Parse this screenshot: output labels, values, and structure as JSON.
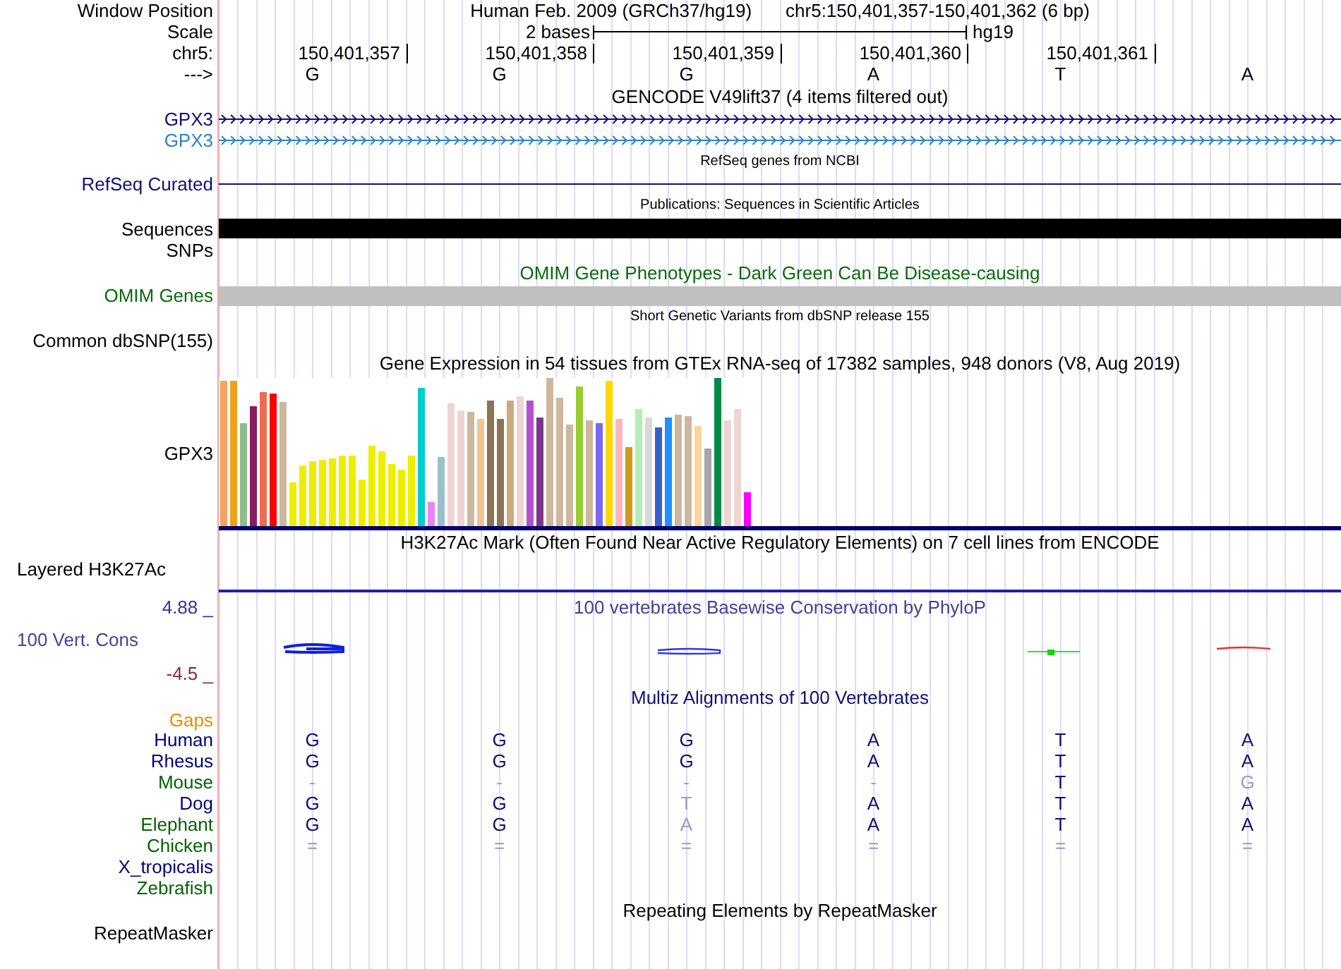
{
  "header": {
    "position_label": "Window Position",
    "assembly": "Human Feb. 2009 (GRCh37/hg19)",
    "position": "chr5:150,401,357-150,401,362 (6 bp)",
    "scale_label": "Scale",
    "scale_length": "2 bases",
    "scale_assembly": "hg19",
    "ruler_label": "chr5:",
    "ruler_ticks": [
      "150,401,357",
      "150,401,358",
      "150,401,359",
      "150,401,360",
      "150,401,361"
    ],
    "strand_label": "--->",
    "bases": [
      "G",
      "G",
      "G",
      "A",
      "T",
      "A"
    ]
  },
  "tracks": [
    {
      "kind": "title",
      "text": "GENCODE V49lift37 (4 items filtered out)"
    },
    {
      "kind": "gene",
      "label": "GPX3"
    },
    {
      "kind": "gene-alt",
      "label": "GPX3"
    },
    {
      "kind": "note",
      "text": "RefSeq genes from NCBI"
    },
    {
      "kind": "line",
      "label": "RefSeq Curated"
    },
    {
      "kind": "note",
      "text": "Publications: Sequences in Scientific Articles"
    },
    {
      "kind": "sequence-bar",
      "label": "Sequences"
    },
    {
      "kind": "label",
      "label": "SNPs"
    },
    {
      "kind": "omim-title",
      "text": "OMIM Gene Phenotypes - Dark Green Can Be Disease-causing"
    },
    {
      "kind": "omim-bar",
      "label": "OMIM Genes"
    },
    {
      "kind": "note",
      "text": "Short Genetic Variants from dbSNP release 155"
    },
    {
      "kind": "label",
      "label": "Common dbSNP(155)"
    },
    {
      "kind": "title",
      "text": "Gene Expression in 54 tissues from GTEx RNA-seq of 17382 samples, 948 donors (V8, Aug 2019)"
    },
    {
      "kind": "expression",
      "label": "GPX3"
    },
    {
      "kind": "title",
      "text": "H3K27Ac Mark (Often Found Near Active Regulatory Elements) on 7 cell lines from ENCODE"
    },
    {
      "kind": "layered",
      "label": "Layered H3K27Ac"
    },
    {
      "kind": "wiggle",
      "title": "100 vertebrates Basewise Conservation by PhyloP",
      "label": "100 Vert. Cons",
      "max": "4.88 _",
      "min": "-4.5 _"
    },
    {
      "kind": "multiz-title",
      "text": "Multiz Alignments of 100 Vertebrates"
    },
    {
      "kind": "gaps",
      "label": "Gaps"
    },
    {
      "kind": "species",
      "label": "Human",
      "color": "#000080",
      "bases": [
        {
          "text": "G",
          "faded": false
        },
        {
          "text": "G",
          "faded": false
        },
        {
          "text": "G",
          "faded": false
        },
        {
          "text": "A",
          "faded": false
        },
        {
          "text": "T",
          "faded": false
        },
        {
          "text": "A",
          "faded": false
        }
      ]
    },
    {
      "kind": "species",
      "label": "Rhesus",
      "color": "#000080",
      "bases": [
        {
          "text": "G",
          "faded": false
        },
        {
          "text": "G",
          "faded": false
        },
        {
          "text": "G",
          "faded": false
        },
        {
          "text": "A",
          "faded": false
        },
        {
          "text": "T",
          "faded": false
        },
        {
          "text": "A",
          "faded": false
        }
      ]
    },
    {
      "kind": "species",
      "label": "Mouse",
      "color": "#006400",
      "bases": [
        {
          "text": "-",
          "faded": true
        },
        {
          "text": "-",
          "faded": true
        },
        {
          "text": "-",
          "faded": true
        },
        {
          "text": "-",
          "faded": true
        },
        {
          "text": "T",
          "faded": false
        },
        {
          "text": "G",
          "faded": true
        }
      ]
    },
    {
      "kind": "species",
      "label": "Dog",
      "color": "#000080",
      "bases": [
        {
          "text": "G",
          "faded": false
        },
        {
          "text": "G",
          "faded": false
        },
        {
          "text": "T",
          "faded": true
        },
        {
          "text": "A",
          "faded": false
        },
        {
          "text": "T",
          "faded": false
        },
        {
          "text": "A",
          "faded": false
        }
      ]
    },
    {
      "kind": "species",
      "label": "Elephant",
      "color": "#006400",
      "bases": [
        {
          "text": "G",
          "faded": false
        },
        {
          "text": "G",
          "faded": false
        },
        {
          "text": "A",
          "faded": true
        },
        {
          "text": "A",
          "faded": false
        },
        {
          "text": "T",
          "faded": false
        },
        {
          "text": "A",
          "faded": false
        }
      ]
    },
    {
      "kind": "species",
      "label": "Chicken",
      "color": "#006400",
      "bases": [
        {
          "text": "=",
          "faded": true
        },
        {
          "text": "=",
          "faded": true
        },
        {
          "text": "=",
          "faded": true
        },
        {
          "text": "=",
          "faded": true
        },
        {
          "text": "=",
          "faded": true
        },
        {
          "text": "=",
          "faded": true
        }
      ]
    },
    {
      "kind": "species",
      "label": "X_tropicalis",
      "color": "#000080"
    },
    {
      "kind": "species",
      "label": "Zebrafish",
      "color": "#006400"
    },
    {
      "kind": "title",
      "text": "Repeating Elements by RepeatMasker"
    },
    {
      "kind": "label",
      "label": "RepeatMasker"
    }
  ]
}
